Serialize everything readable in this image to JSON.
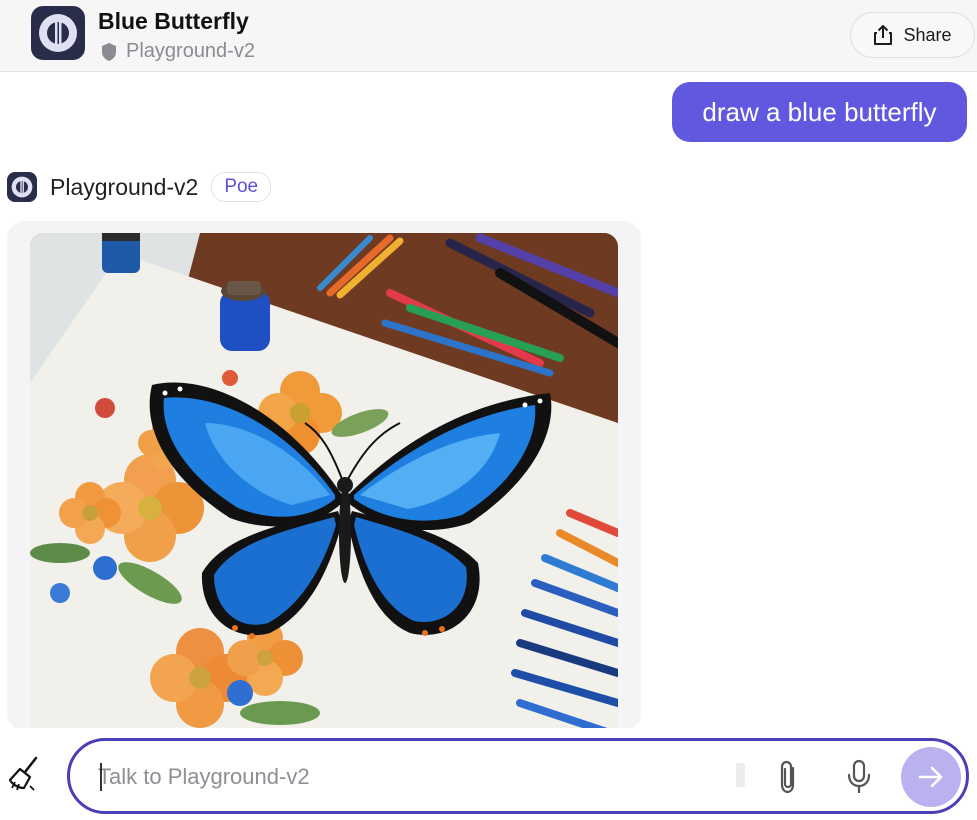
{
  "header": {
    "title": "Blue Butterfly",
    "bot_name": "Playground-v2",
    "share_label": "Share",
    "icons": {
      "avatar": "playground-logo-icon",
      "privacy": "shield-icon",
      "share": "share-icon"
    }
  },
  "messages": {
    "user": {
      "text": "draw a blue butterfly"
    },
    "bot": {
      "name": "Playground-v2",
      "tag": "Poe",
      "image_icon": "butterfly-illustration"
    }
  },
  "composer": {
    "placeholder": "Talk to Playground-v2",
    "value": "",
    "icons": {
      "clear": "broom-icon",
      "attach": "paperclip-icon",
      "mic": "microphone-icon",
      "send": "arrow-right-icon"
    }
  },
  "colors": {
    "accent": "#6158e0",
    "composer_border": "#4b3fb8",
    "send_button": "#b9b2ef",
    "butterfly_blue": "#1f7fe0"
  }
}
